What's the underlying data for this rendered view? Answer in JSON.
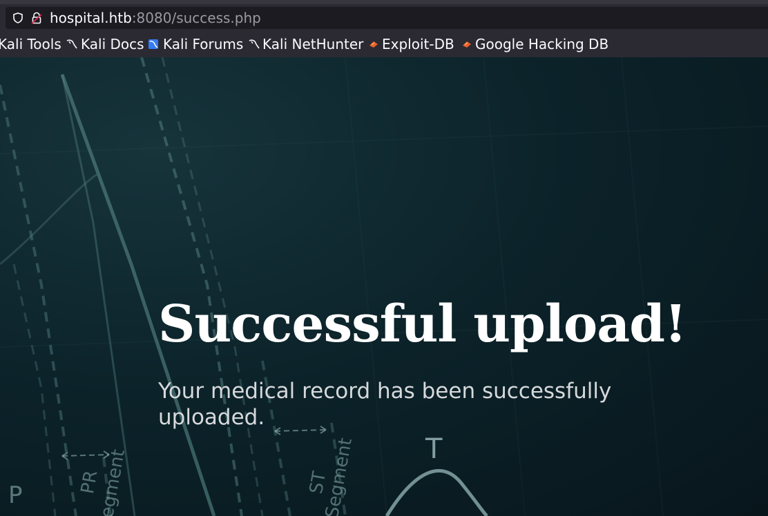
{
  "browser": {
    "url": {
      "host": "hospital.htb",
      "rest": ":8080/success.php"
    },
    "bookmarks": [
      {
        "label": "Kali Tools",
        "icon": "kali-dragon-icon"
      },
      {
        "label": "Kali Docs",
        "icon": "kali-dragon-icon"
      },
      {
        "label": "Kali Forums",
        "icon": "kali-forums-icon"
      },
      {
        "label": "Kali NetHunter",
        "icon": "kali-dragon-icon"
      },
      {
        "label": "Exploit-DB",
        "icon": "exploit-db-icon"
      },
      {
        "label": "Google Hacking DB",
        "icon": "exploit-db-icon"
      }
    ]
  },
  "page": {
    "title": "Successful upload!",
    "message": "Your medical record has been successfully uploaded.",
    "background_labels": [
      "PR",
      "egment",
      "ST",
      "Segment",
      "P",
      "T"
    ]
  },
  "colors": {
    "hero_bg": "#0c232a",
    "accent_lines": "#5f8f8f",
    "exploit_orange": "#e8622a"
  }
}
